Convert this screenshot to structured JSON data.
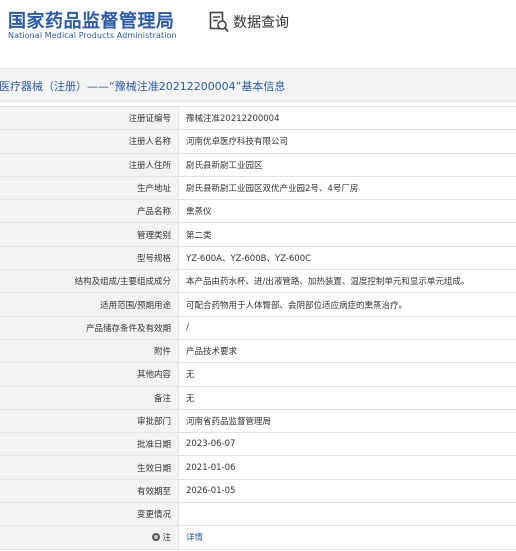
{
  "header": {
    "logo_cn": "国家药品监督管理局",
    "logo_en": "National Medical Products Administration",
    "query_icon": "search-doc-icon",
    "query_label": "数据查询"
  },
  "title_bar": {
    "text": "医疗器械（注册）——“豫械注准20212200004”基本信息"
  },
  "rows": [
    {
      "label": "注册证编号",
      "value": "豫械注准20212200004"
    },
    {
      "label": "注册人名称",
      "value": "河南优卓医疗科技有限公司"
    },
    {
      "label": "注册人住所",
      "value": "尉氏县新尉工业园区"
    },
    {
      "label": "生产地址",
      "value": "尉氏县新尉工业园区双优产业园2号、4号厂房"
    },
    {
      "label": "产品名称",
      "value": "熏蒸仪"
    },
    {
      "label": "管理类别",
      "value": "第二类"
    },
    {
      "label": "型号规格",
      "value": "YZ-600A、YZ-600B、YZ-600C"
    },
    {
      "label": "结构及组成/主要组成成分",
      "value": "本产品由药水杯、进/出液管路、加热装置、温度控制单元和显示单元组成。"
    },
    {
      "label": "适用范围/预期用途",
      "value": "可配合药物用于人体臀部、会阴部位适应病症的熏蒸治疗。"
    },
    {
      "label": "产品储存条件及有效期",
      "value": "/"
    },
    {
      "label": "附件",
      "value": "产品技术要求"
    },
    {
      "label": "其他内容",
      "value": "无"
    },
    {
      "label": "备注",
      "value": "无"
    },
    {
      "label": "审批部门",
      "value": "河南省药品监督管理局"
    },
    {
      "label": "批准日期",
      "value": "2023-06-07"
    },
    {
      "label": "生效日期",
      "value": "2021-01-06"
    },
    {
      "label": "有效期至",
      "value": "2026-01-05"
    },
    {
      "label": "变更情况",
      "value": ""
    },
    {
      "label": "注",
      "value": "详情",
      "icon": "note-icon",
      "link": true
    }
  ]
}
